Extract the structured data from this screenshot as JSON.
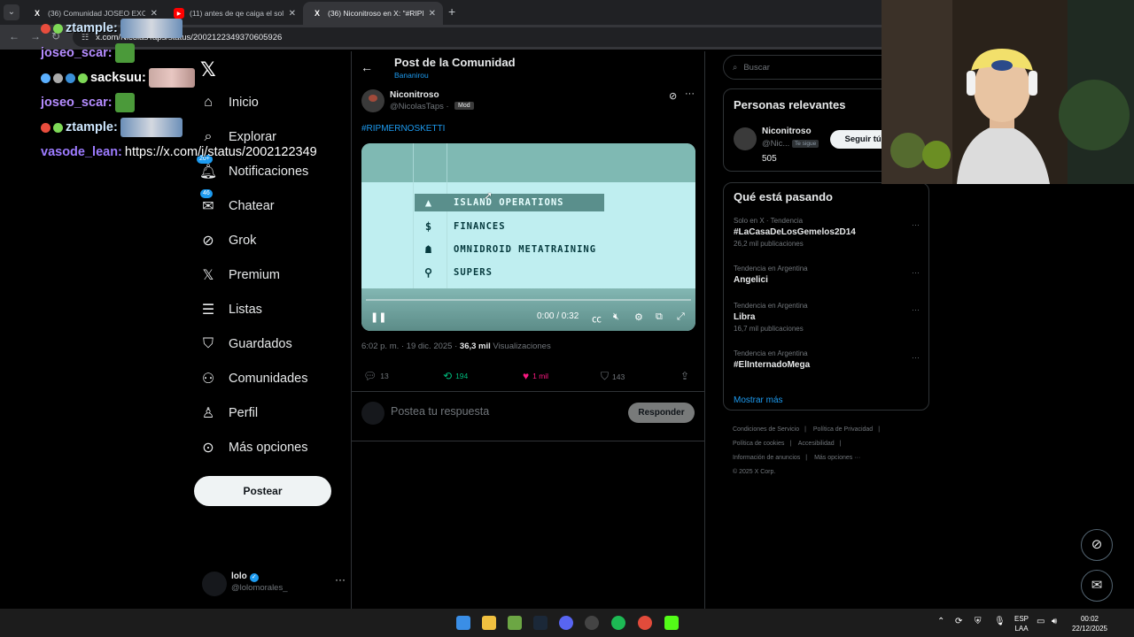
{
  "browser": {
    "tabs": [
      {
        "title": "(36) Comunidad JOSEO EXCO",
        "active": false
      },
      {
        "title": "(11) antes de qe caiga el sol - Y",
        "active": false
      },
      {
        "title": "(36) Niconitroso en X: \"#RIPME",
        "active": true
      }
    ],
    "url": "x.com/NicolasTaps/status/2002122349370605926"
  },
  "chat": [
    {
      "user": "ztample:",
      "message": ""
    },
    {
      "user": "joseo_scar:",
      "message": ""
    },
    {
      "user": "sacksuu:",
      "message": ""
    },
    {
      "user": "joseo_scar:",
      "message": ""
    },
    {
      "user": "ztample:",
      "message": ""
    },
    {
      "user": "vasode_lean:",
      "message": "https://x.com/i/status/2002122349"
    }
  ],
  "nav": {
    "items": [
      {
        "label": "Inicio",
        "icon": "home-icon"
      },
      {
        "label": "Explorar",
        "icon": "search-icon"
      },
      {
        "label": "Notificaciones",
        "icon": "bell-icon",
        "badge": "20+"
      },
      {
        "label": "Chatear",
        "icon": "mail-icon",
        "badge": "46"
      },
      {
        "label": "Grok",
        "icon": "grok-icon"
      },
      {
        "label": "Premium",
        "icon": "x-icon"
      },
      {
        "label": "Listas",
        "icon": "list-icon"
      },
      {
        "label": "Guardados",
        "icon": "bookmark-icon"
      },
      {
        "label": "Comunidades",
        "icon": "people-icon"
      },
      {
        "label": "Perfil",
        "icon": "person-icon"
      },
      {
        "label": "Más opciones",
        "icon": "more-circle-icon"
      }
    ],
    "post_button": "Postear",
    "account": {
      "name": "lolo",
      "handle": "@lolomorales_"
    }
  },
  "header": {
    "title": "Post de la Comunidad",
    "community": "Bananirou"
  },
  "tweet": {
    "name": "Niconitroso",
    "handle": "@NicolasTaps",
    "separator": "·",
    "badge": "Mod",
    "text": "#RIPMERNOSKETTI",
    "time": "6:02 p. m. · 19 dic. 2025 ·",
    "views_count": "36,3 mil",
    "views_label": "Visualizaciones",
    "video": {
      "menu": [
        {
          "icon": "▲",
          "label": "ISLAND OPERATIONS"
        },
        {
          "icon": "$",
          "label": "FINANCES"
        },
        {
          "icon": "☗",
          "label": "OMNIDROID METATRAINING"
        },
        {
          "icon": "⚲",
          "label": "SUPERS"
        }
      ],
      "selected_index": 0,
      "time": "0:00 / 0:32",
      "progress": 0.0
    },
    "replies": "13",
    "retweets": "194",
    "likes": "1 mil",
    "bookmarks": "143"
  },
  "reply": {
    "placeholder": "Postea tu respuesta",
    "button": "Responder"
  },
  "right": {
    "search_placeholder": "Buscar",
    "relevant_title": "Personas relevantes",
    "relevant": {
      "name": "Niconitroso",
      "handle": "@Nic...",
      "tag": "Te sigue",
      "count": "505",
      "follow": "Seguir tú t"
    },
    "trends_title": "Qué está pasando",
    "trends": [
      {
        "context": "Solo en X · Tendencia",
        "name": "#LaCasaDeLosGemelos2D14",
        "count": "26,2 mil publicaciones"
      },
      {
        "context": "Tendencia en Argentina",
        "name": "Angelici",
        "count": ""
      },
      {
        "context": "Tendencia en Argentina",
        "name": "Libra",
        "count": "16,7 mil publicaciones"
      },
      {
        "context": "Tendencia en Argentina",
        "name": "#ElInternadoMega",
        "count": ""
      }
    ],
    "show_more": "Mostrar más",
    "footer": [
      "Condiciones de Servicio",
      "|",
      "Política de Privacidad",
      "|",
      "Política de cookies",
      "|",
      "Accesibilidad",
      "|",
      "Información de anuncios",
      "|",
      "Más opciones ···",
      "© 2025 X Corp."
    ]
  },
  "taskbar": {
    "lang": "ESP",
    "lang2": "LAA",
    "time": "00:02",
    "date": "22/12/2025"
  }
}
